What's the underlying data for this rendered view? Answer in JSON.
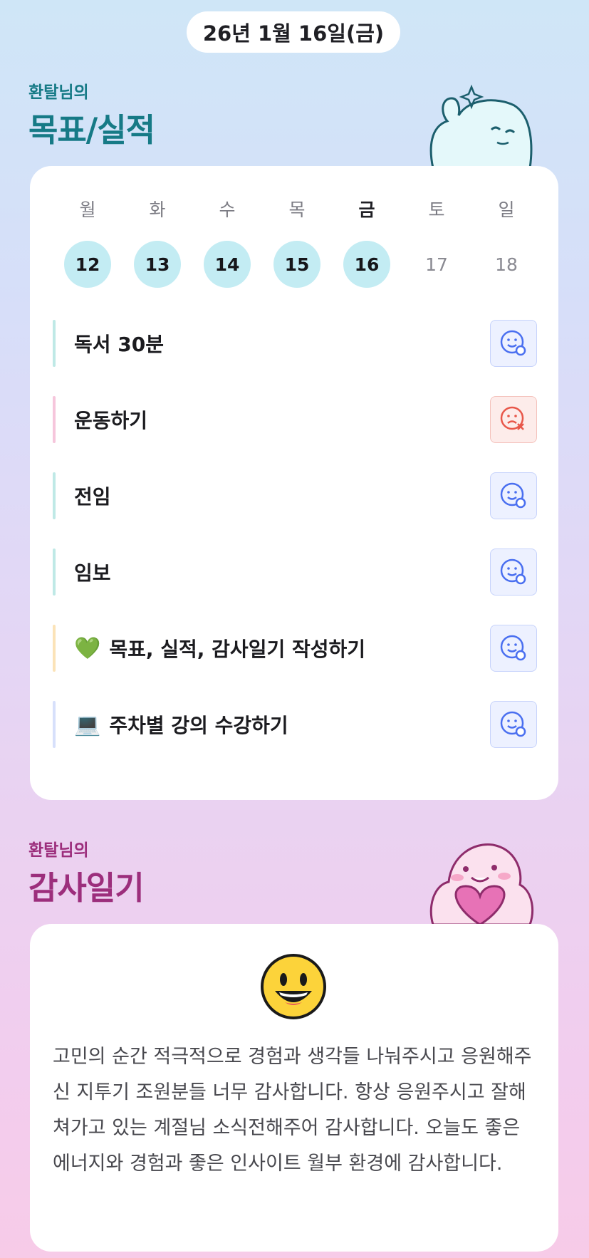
{
  "header": {
    "date_label": "26년 1월 16일(금)"
  },
  "goal_section": {
    "owner_label": "환탈님의",
    "title": "목표/실적",
    "weekdays": [
      {
        "label": "월",
        "active": false
      },
      {
        "label": "화",
        "active": false
      },
      {
        "label": "수",
        "active": false
      },
      {
        "label": "목",
        "active": false
      },
      {
        "label": "금",
        "active": true
      },
      {
        "label": "토",
        "active": false
      },
      {
        "label": "일",
        "active": false
      }
    ],
    "dates": [
      {
        "label": "12",
        "done": true
      },
      {
        "label": "13",
        "done": true
      },
      {
        "label": "14",
        "done": true
      },
      {
        "label": "15",
        "done": true
      },
      {
        "label": "16",
        "done": true
      },
      {
        "label": "17",
        "done": false
      },
      {
        "label": "18",
        "done": false
      }
    ],
    "goals": [
      {
        "emoji": "",
        "label": "독서 30분",
        "bar_color": "#bfe9e6",
        "status": "success",
        "status_icon": "smile-check-icon"
      },
      {
        "emoji": "",
        "label": "운동하기",
        "bar_color": "#f6c6dc",
        "status": "fail",
        "status_icon": "sad-x-icon"
      },
      {
        "emoji": "",
        "label": "전임",
        "bar_color": "#bfe9e6",
        "status": "success",
        "status_icon": "smile-check-icon"
      },
      {
        "emoji": "",
        "label": "임보",
        "bar_color": "#bfe9e6",
        "status": "success",
        "status_icon": "smile-check-icon"
      },
      {
        "emoji": "💚",
        "label": "목표, 실적, 감사일기 작성하기",
        "bar_color": "#fbe3b8",
        "status": "success",
        "status_icon": "smile-check-icon"
      },
      {
        "emoji": "💻",
        "label": "주차별 강의 수강하기",
        "bar_color": "#d7e0fb",
        "status": "success",
        "status_icon": "smile-check-icon"
      }
    ]
  },
  "gratitude_section": {
    "owner_label": "환탈님의",
    "title": "감사일기",
    "emoji_icon": "grinning-face-icon",
    "text": "고민의 순간 적극적으로 경험과 생각들 나눠주시고 응원해주신 지투기 조원분들 너무 감사합니다. 항상 응원주시고 잘해쳐가고 있는 계절님 소식전해주어 감사합니다. 오늘도 좋은 에너지와 경험과 좋은 인사이트 월부 환경에 감사합니다."
  },
  "colors": {
    "goal_title": "#167a86",
    "gratitude_title": "#9c2e7c",
    "done_circle": "#c3ecf3",
    "success_icon": "#4a6ff0",
    "fail_icon": "#e8574a"
  }
}
